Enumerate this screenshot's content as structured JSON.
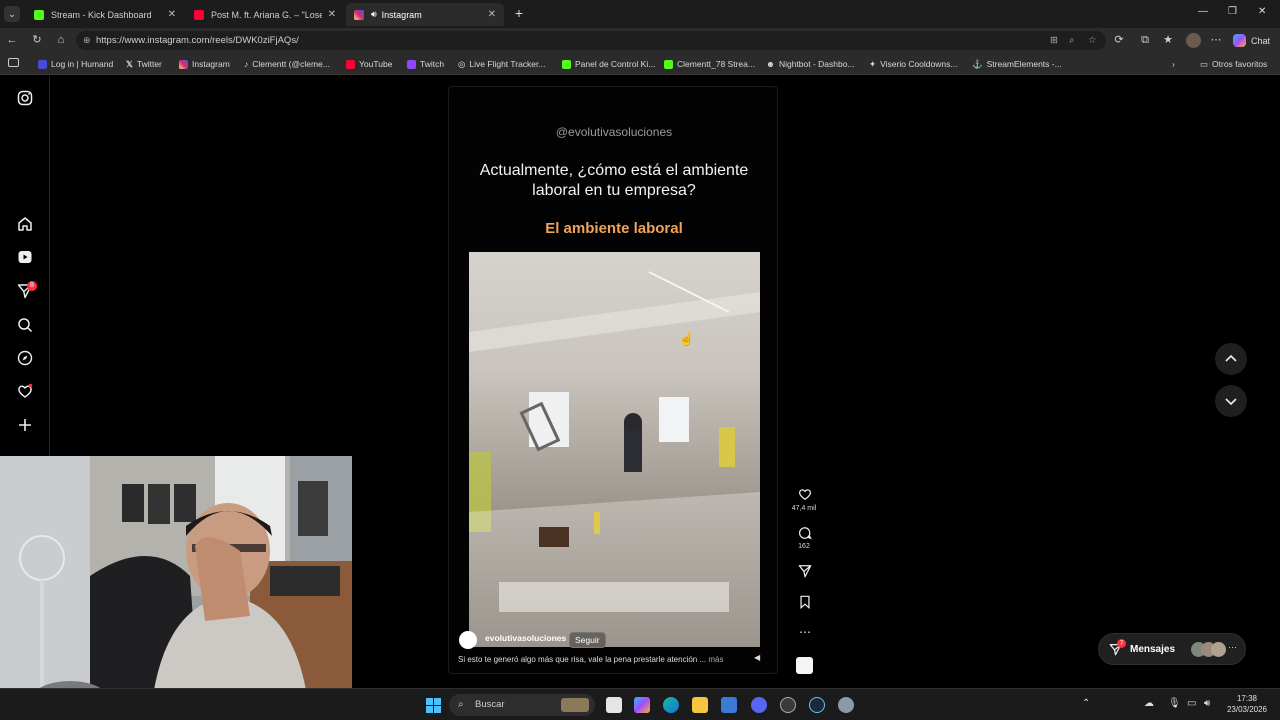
{
  "browser": {
    "tabs": [
      {
        "label": "Stream - Kick Dashboard",
        "active": false
      },
      {
        "label": "Post M. ft. Ariana G. – \"Lose Contr",
        "active": false
      },
      {
        "label": "Instagram",
        "active": true
      }
    ],
    "url": "https://www.instagram.com/reels/DWK0ziFjAQs/",
    "bookmarks": [
      "Log in | Humand",
      "Twitter",
      "Instagram",
      "Clementt (@cleme...",
      "YouTube",
      "Twitch",
      "Live Flight Tracker...",
      "Panel de Control Ki...",
      "Clementt_78 Strea...",
      "Nightbot - Dashbo...",
      "Viserio Cooldowns...",
      "StreamElements -..."
    ],
    "other_favorites": "Otros favoritos",
    "chat_label": "Chat"
  },
  "instagram": {
    "notification_badge": "8",
    "reel": {
      "handle": "@evolutivasoluciones",
      "question": "Actualmente, ¿cómo está el ambiente laboral en tu empresa?",
      "headline": "El ambiente laboral",
      "author": "evolutivasoluciones",
      "follow_label": "Seguir",
      "caption": "Si esto te generó algo más que risa, vale la pena prestarle atención ...",
      "more_label": "más"
    },
    "actions": {
      "likes": "47,4 mil",
      "comments": "162"
    },
    "messages": {
      "label": "Mensajes",
      "badge": "7"
    }
  },
  "taskbar": {
    "search_placeholder": "Buscar",
    "time": "17:38",
    "date": "23/03/2026"
  },
  "colors": {
    "accent_orange": "#f0a35a",
    "kick_green": "#53fc18",
    "notification_red": "#ff3040"
  }
}
